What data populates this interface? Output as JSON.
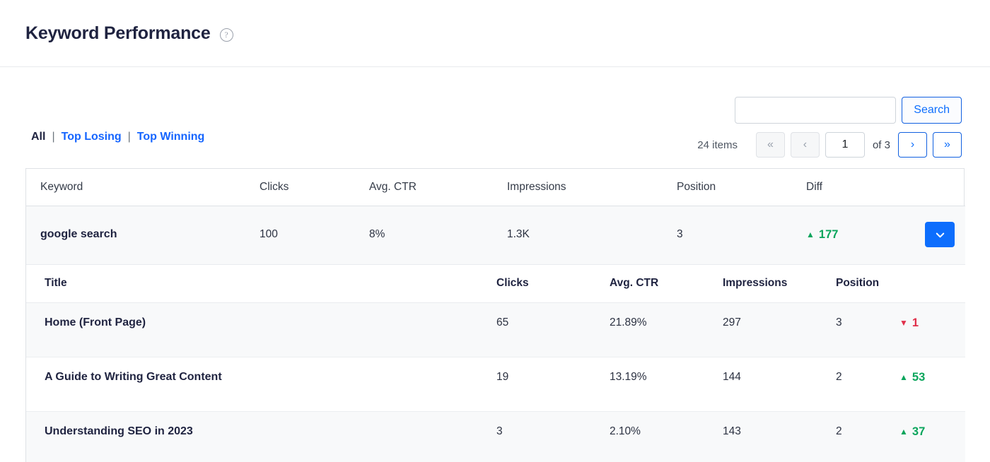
{
  "header": {
    "title": "Keyword Performance",
    "help_icon": "question-circle-icon",
    "help_glyph": "?"
  },
  "toolbar": {
    "search": {
      "value": "",
      "placeholder": "",
      "button_label": "Search"
    },
    "filters": {
      "active": "All",
      "separator": "|",
      "top_losing": "Top Losing",
      "top_winning": "Top Winning"
    },
    "pagination": {
      "items_label": "24 items",
      "first_glyph": "«",
      "prev_glyph": "‹",
      "page_value": "1",
      "of_label": "of 3",
      "next_glyph": "›",
      "last_glyph": "»"
    }
  },
  "table": {
    "columns": [
      "Keyword",
      "Clicks",
      "Avg. CTR",
      "Impressions",
      "Position",
      "Diff",
      ""
    ],
    "row": {
      "keyword": "google search",
      "clicks": "100",
      "avg_ctr": "8%",
      "impressions": "1.3K",
      "position": "3",
      "diff": {
        "value": "177",
        "direction": "up",
        "glyph": "▲"
      },
      "expand_icon": "chevron-down-icon",
      "expand_glyph": "❯"
    },
    "nested": {
      "columns": [
        "Title",
        "Clicks",
        "Avg. CTR",
        "Impressions",
        "Position",
        ""
      ],
      "rows": [
        {
          "title": "Home (Front Page)",
          "clicks": "65",
          "avg_ctr": "21.89%",
          "impressions": "297",
          "position": "3",
          "diff": {
            "value": "1",
            "direction": "down",
            "glyph": "▼"
          }
        },
        {
          "title": "A Guide to Writing Great Content",
          "clicks": "19",
          "avg_ctr": "13.19%",
          "impressions": "144",
          "position": "2",
          "diff": {
            "value": "53",
            "direction": "up",
            "glyph": "▲"
          }
        },
        {
          "title": "Understanding SEO in 2023",
          "clicks": "3",
          "avg_ctr": "2.10%",
          "impressions": "143",
          "position": "2",
          "diff": {
            "value": "37",
            "direction": "up",
            "glyph": "▲"
          }
        }
      ]
    }
  },
  "colors": {
    "accent_blue": "#0d6efd",
    "link_blue": "#1565ff",
    "up_green": "#0aa55c",
    "down_red": "#e0304a",
    "title_navy": "#1f2340",
    "row_stripe": "#f8f9fa"
  }
}
